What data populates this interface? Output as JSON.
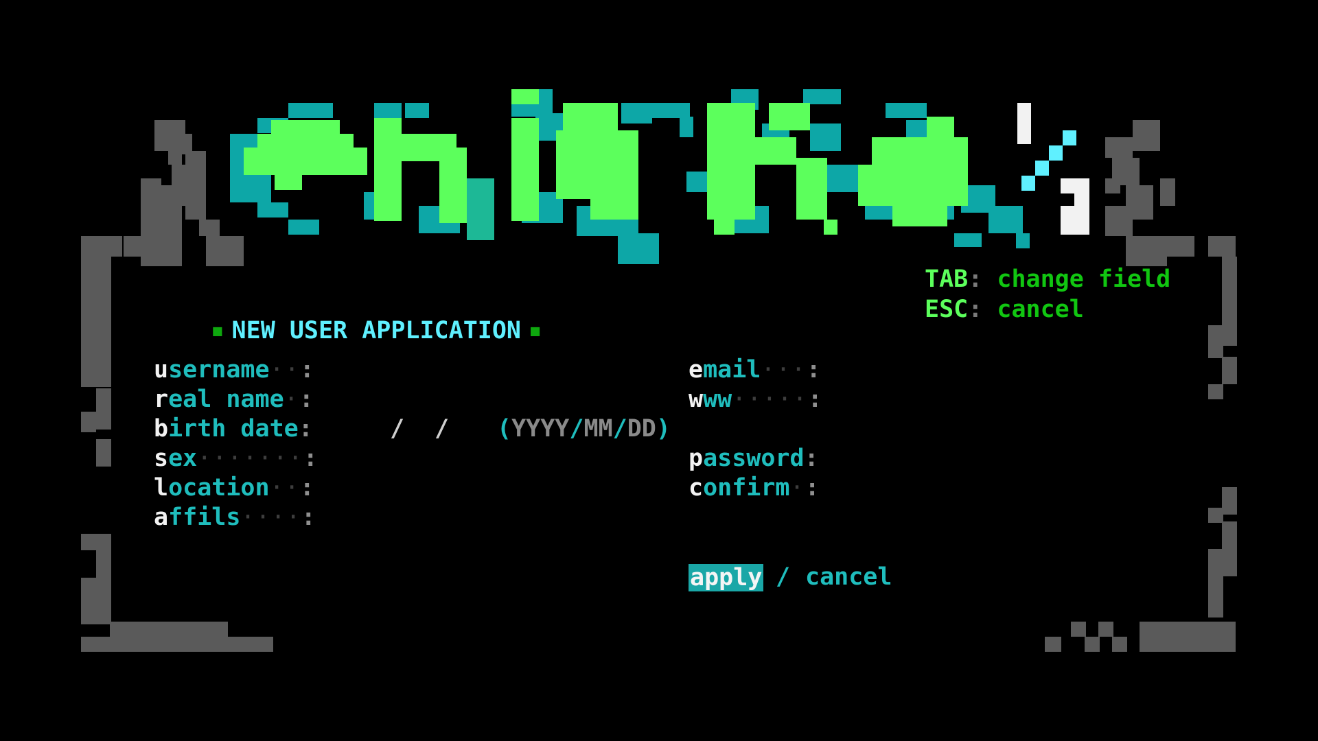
{
  "logo": {
    "text": "enigma½"
  },
  "colors": {
    "background": "#000000",
    "frame_gray": "#5a5a5a",
    "logo_green": "#5cff5c",
    "logo_teal": "#0da7a7",
    "label_cyan": "#1fbdbd",
    "help_key_green": "#5cff5c",
    "help_desc_green": "#11c611",
    "apply_highlight": "#1aa7a7"
  },
  "header": {
    "title": "NEW USER APPLICATION",
    "bullet": "■"
  },
  "help": {
    "items": [
      {
        "key": "TAB",
        "sep": ":",
        "desc": "change field"
      },
      {
        "key": "ESC",
        "sep": ":",
        "desc": "cancel"
      }
    ]
  },
  "form": {
    "left": [
      {
        "head": "u",
        "rest": "sername",
        "dots": "··",
        "colon": ":",
        "value": ""
      },
      {
        "head": "r",
        "rest": "eal name",
        "dots": "·",
        "colon": ":",
        "value": ""
      },
      {
        "head": "b",
        "rest": "irth date",
        "dots": "",
        "colon": ":",
        "value": ""
      },
      {
        "head": "s",
        "rest": "ex",
        "dots": "·······",
        "colon": ":",
        "value": ""
      },
      {
        "head": "l",
        "rest": "ocation",
        "dots": "··",
        "colon": ":",
        "value": ""
      },
      {
        "head": "a",
        "rest": "ffils",
        "dots": "····",
        "colon": ":",
        "value": ""
      }
    ],
    "right": [
      {
        "head": "e",
        "rest": "mail",
        "dots": "···",
        "colon": ":",
        "value": ""
      },
      {
        "head": "w",
        "rest": "ww",
        "dots": "·····",
        "colon": ":",
        "value": ""
      },
      {
        "head": "p",
        "rest": "assword",
        "dots": "",
        "colon": ":",
        "value": ""
      },
      {
        "head": "c",
        "rest": "onfirm",
        "dots": "·",
        "colon": ":",
        "value": ""
      }
    ],
    "birth_date": {
      "sep1": "/",
      "sep2": "/",
      "fmt_open": "(",
      "fmt_y": "YYYY",
      "fmt_s1": "/",
      "fmt_m": "MM",
      "fmt_s2": "/",
      "fmt_d": "DD",
      "fmt_close": ")"
    }
  },
  "buttons": {
    "apply": "apply",
    "separator": "/",
    "cancel": "cancel"
  }
}
